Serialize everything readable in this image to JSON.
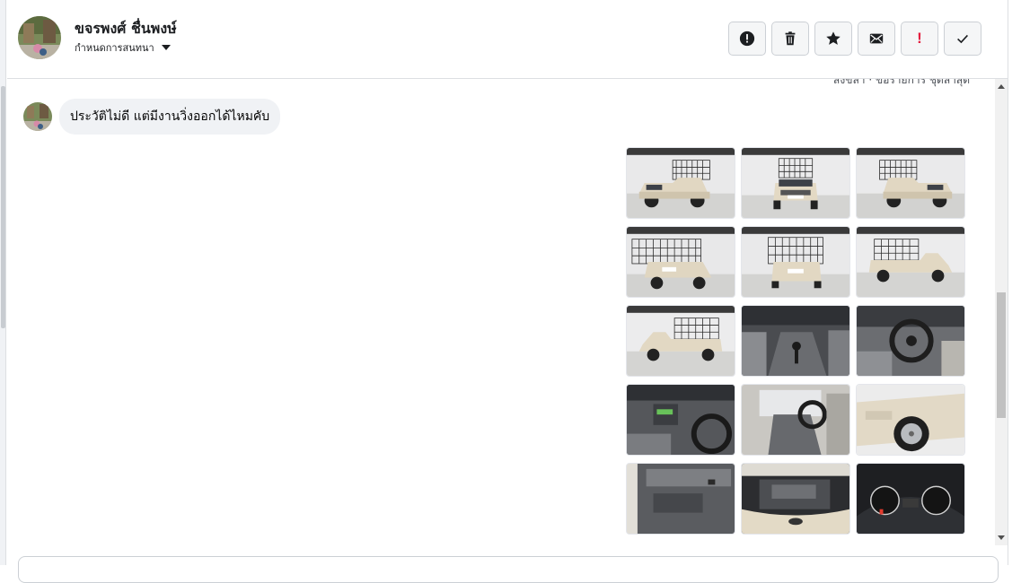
{
  "header": {
    "contact_name": "ขจรพงศ์ ชื่นพงษ์",
    "subtitle": "กำหนดการสนทนา",
    "actions": [
      {
        "name": "report-button",
        "icon": "alert-circle-icon"
      },
      {
        "name": "delete-button",
        "icon": "trash-icon"
      },
      {
        "name": "star-button",
        "icon": "star-icon"
      },
      {
        "name": "mark-unread-button",
        "icon": "envelope-icon"
      },
      {
        "name": "important-button",
        "icon": "exclamation-icon"
      },
      {
        "name": "done-button",
        "icon": "checkmark-icon"
      }
    ]
  },
  "chat": {
    "truncated_text": "สงขลา · ขอรายการ ชุดล่าสุด",
    "message": "ประวัติไม่ดี แต่มีงานวิ่งออกได้ไหมคับ",
    "photos": [
      {
        "name": "photo-1",
        "scene": "truck-front-left"
      },
      {
        "name": "photo-2",
        "scene": "truck-front"
      },
      {
        "name": "photo-3",
        "scene": "truck-front-right"
      },
      {
        "name": "photo-4",
        "scene": "truck-rear-left"
      },
      {
        "name": "photo-5",
        "scene": "truck-rear"
      },
      {
        "name": "photo-6",
        "scene": "truck-side-right"
      },
      {
        "name": "photo-7",
        "scene": "truck-side-left"
      },
      {
        "name": "photo-8",
        "scene": "interior-gear"
      },
      {
        "name": "photo-9",
        "scene": "interior-steering"
      },
      {
        "name": "photo-10",
        "scene": "interior-dash"
      },
      {
        "name": "photo-11",
        "scene": "interior-seat"
      },
      {
        "name": "photo-12",
        "scene": "wheel-closeup"
      },
      {
        "name": "photo-13",
        "scene": "door-panel"
      },
      {
        "name": "photo-14",
        "scene": "engine-bay"
      },
      {
        "name": "photo-15",
        "scene": "gauge-cluster"
      }
    ]
  },
  "colors": {
    "bubble_bg": "#f0f2f5",
    "alert_red": "#e41e3f",
    "border": "#dddfe2"
  }
}
